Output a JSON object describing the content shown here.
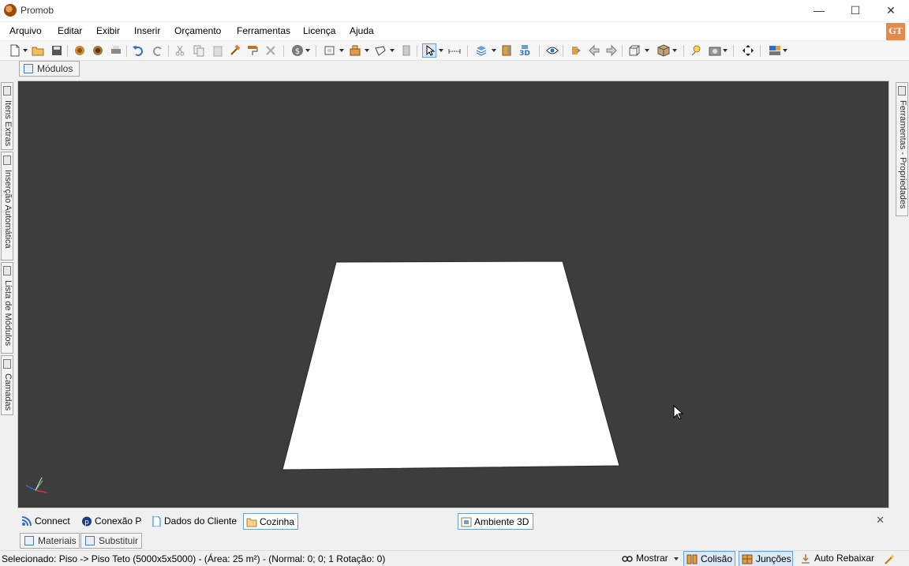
{
  "window": {
    "title": "Promob",
    "controls": {
      "minimize": "—",
      "maximize": "☐",
      "close": "✕"
    }
  },
  "menu": {
    "items": [
      "Arquivo",
      "Editar",
      "Exibir",
      "Inserir",
      "Orçamento",
      "Ferramentas",
      "Licença",
      "Ajuda"
    ],
    "user_badge": "GT"
  },
  "tabs_top": {
    "modules": "Módulos"
  },
  "left_panels": [
    "Itens Extras",
    "Inserção Automática",
    "Lista de Módulos",
    "Camadas"
  ],
  "right_panels": [
    "Ferramentas - Propriedades"
  ],
  "viewport": {
    "background": "#3d3d3d",
    "floor_color": "#ffffff"
  },
  "bottom_tabs": {
    "connect": "Connect",
    "conexao": "Conexão P",
    "dados_cliente": "Dados do Cliente",
    "cozinha": "Cozinha",
    "ambiente": "Ambiente 3D",
    "close": "✕"
  },
  "lower_tabs": {
    "materiais": "Materiais",
    "substituir": "Substituir"
  },
  "status": {
    "text": "Selecionado: Piso -> Piso Teto (5000x5x5000) - (Área: 25 m²) - (Normal: 0; 0; 1 Rotação: 0)",
    "mostrar": "Mostrar",
    "colisao": "Colisão",
    "juncoes": "Junções",
    "auto_rebaixar": "Auto Rebaixar"
  },
  "accent_color": "#2a6fc9"
}
